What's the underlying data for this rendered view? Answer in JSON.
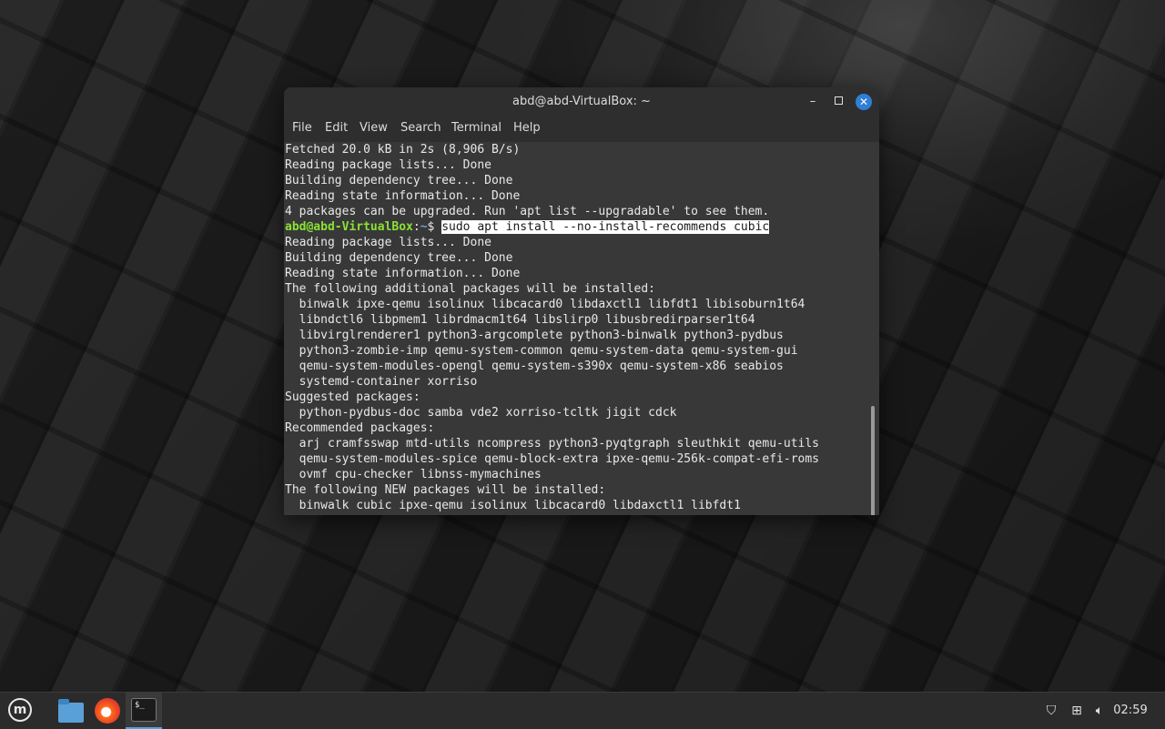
{
  "window": {
    "title": "abd@abd-VirtualBox: ~",
    "controls": {
      "minimize": "–",
      "close": "✕"
    }
  },
  "menu": [
    "File",
    "Edit",
    "View",
    "Search",
    "Terminal",
    "Help"
  ],
  "terminal": {
    "lines_before": [
      "Fetched 20.0 kB in 2s (8,906 B/s)",
      "Reading package lists... Done",
      "Building dependency tree... Done",
      "Reading state information... Done",
      "4 packages can be upgraded. Run 'apt list --upgradable' to see them."
    ],
    "prompt": {
      "user_host": "abd@abd-VirtualBox",
      "sep": ":",
      "path": "~",
      "symbol": "$ "
    },
    "command": "sudo apt install --no-install-recommends cubic",
    "lines_after": [
      "Reading package lists... Done",
      "Building dependency tree... Done",
      "Reading state information... Done",
      "The following additional packages will be installed:",
      "  binwalk ipxe-qemu isolinux libcacard0 libdaxctl1 libfdt1 libisoburn1t64",
      "  libndctl6 libpmem1 librdmacm1t64 libslirp0 libusbredirparser1t64",
      "  libvirglrenderer1 python3-argcomplete python3-binwalk python3-pydbus",
      "  python3-zombie-imp qemu-system-common qemu-system-data qemu-system-gui",
      "  qemu-system-modules-opengl qemu-system-s390x qemu-system-x86 seabios",
      "  systemd-container xorriso",
      "Suggested packages:",
      "  python-pydbus-doc samba vde2 xorriso-tcltk jigit cdck",
      "Recommended packages:",
      "  arj cramfsswap mtd-utils ncompress python3-pyqtgraph sleuthkit qemu-utils",
      "  qemu-system-modules-spice qemu-block-extra ipxe-qemu-256k-compat-efi-roms",
      "  ovmf cpu-checker libnss-mymachines",
      "The following NEW packages will be installed:",
      "  binwalk cubic ipxe-qemu isolinux libcacard0 libdaxctl1 libfdt1"
    ]
  },
  "taskbar": {
    "menu_icon": "linux-mint-logo-icon",
    "launchers": [
      "files-folder-icon",
      "firefox-icon",
      "terminal-icon"
    ],
    "terminal_icon_text": "$_",
    "tray_icons": [
      "shield-icon",
      "network-icon",
      "volume-icon"
    ],
    "clock": "02:59"
  }
}
